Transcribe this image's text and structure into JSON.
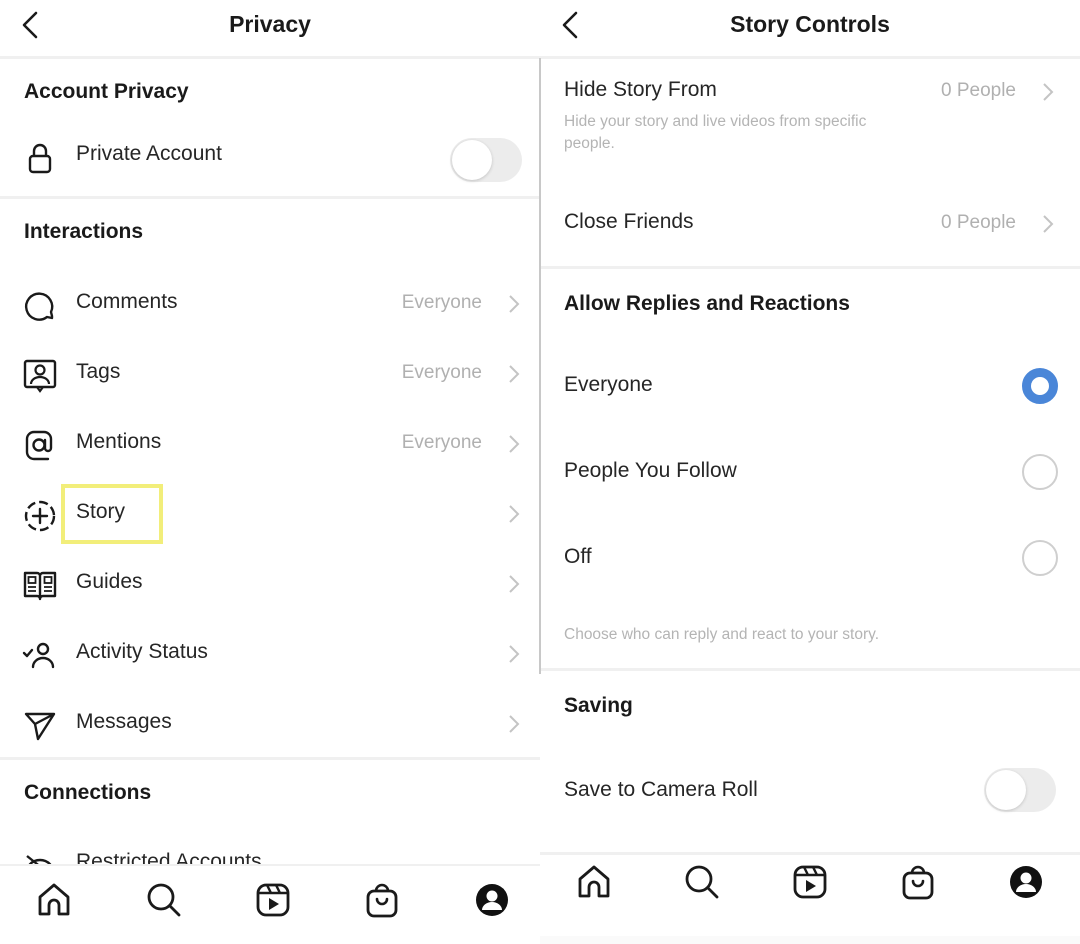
{
  "left": {
    "header": {
      "title": "Privacy",
      "back_icon": "chevron-left-icon"
    },
    "sections": {
      "account_privacy": {
        "title": "Account Privacy",
        "items": [
          {
            "label": "Private Account",
            "icon": "lock-icon",
            "toggle_on": false
          }
        ]
      },
      "interactions": {
        "title": "Interactions",
        "items": [
          {
            "label": "Comments",
            "value": "Everyone",
            "icon": "comment-icon"
          },
          {
            "label": "Tags",
            "value": "Everyone",
            "icon": "tag-person-icon"
          },
          {
            "label": "Mentions",
            "value": "Everyone",
            "icon": "at-sign-icon"
          },
          {
            "label": "Story",
            "value": "",
            "icon": "story-add-icon",
            "highlighted": true
          },
          {
            "label": "Guides",
            "value": "",
            "icon": "guides-icon"
          },
          {
            "label": "Activity Status",
            "value": "",
            "icon": "activity-status-icon"
          },
          {
            "label": "Messages",
            "value": "",
            "icon": "paper-plane-icon"
          }
        ]
      },
      "connections": {
        "title": "Connections",
        "items": [
          {
            "label": "Restricted Accounts",
            "icon": "restricted-icon"
          }
        ]
      }
    },
    "highlight_color": "#f2ee7a"
  },
  "right": {
    "header": {
      "title": "Story Controls",
      "back_icon": "chevron-left-icon"
    },
    "hide_story_from": {
      "label": "Hide Story From",
      "value": "0 People",
      "description": "Hide your story and live videos from specific people."
    },
    "close_friends": {
      "label": "Close Friends",
      "value": "0 People"
    },
    "replies": {
      "title": "Allow Replies and Reactions",
      "options": [
        {
          "label": "Everyone",
          "selected": true
        },
        {
          "label": "People You Follow",
          "selected": false
        },
        {
          "label": "Off",
          "selected": false
        }
      ],
      "note": "Choose who can reply and react to your story."
    },
    "saving": {
      "title": "Saving",
      "items": [
        {
          "label": "Save to Camera Roll",
          "toggle_on": false
        }
      ]
    },
    "accent_color": "#4a86d8"
  },
  "tabbar": {
    "tabs": [
      {
        "name": "home",
        "icon": "home-icon"
      },
      {
        "name": "search",
        "icon": "search-icon"
      },
      {
        "name": "reels",
        "icon": "reels-icon"
      },
      {
        "name": "shop",
        "icon": "shop-bag-icon"
      },
      {
        "name": "profile",
        "icon": "profile-icon"
      }
    ]
  }
}
